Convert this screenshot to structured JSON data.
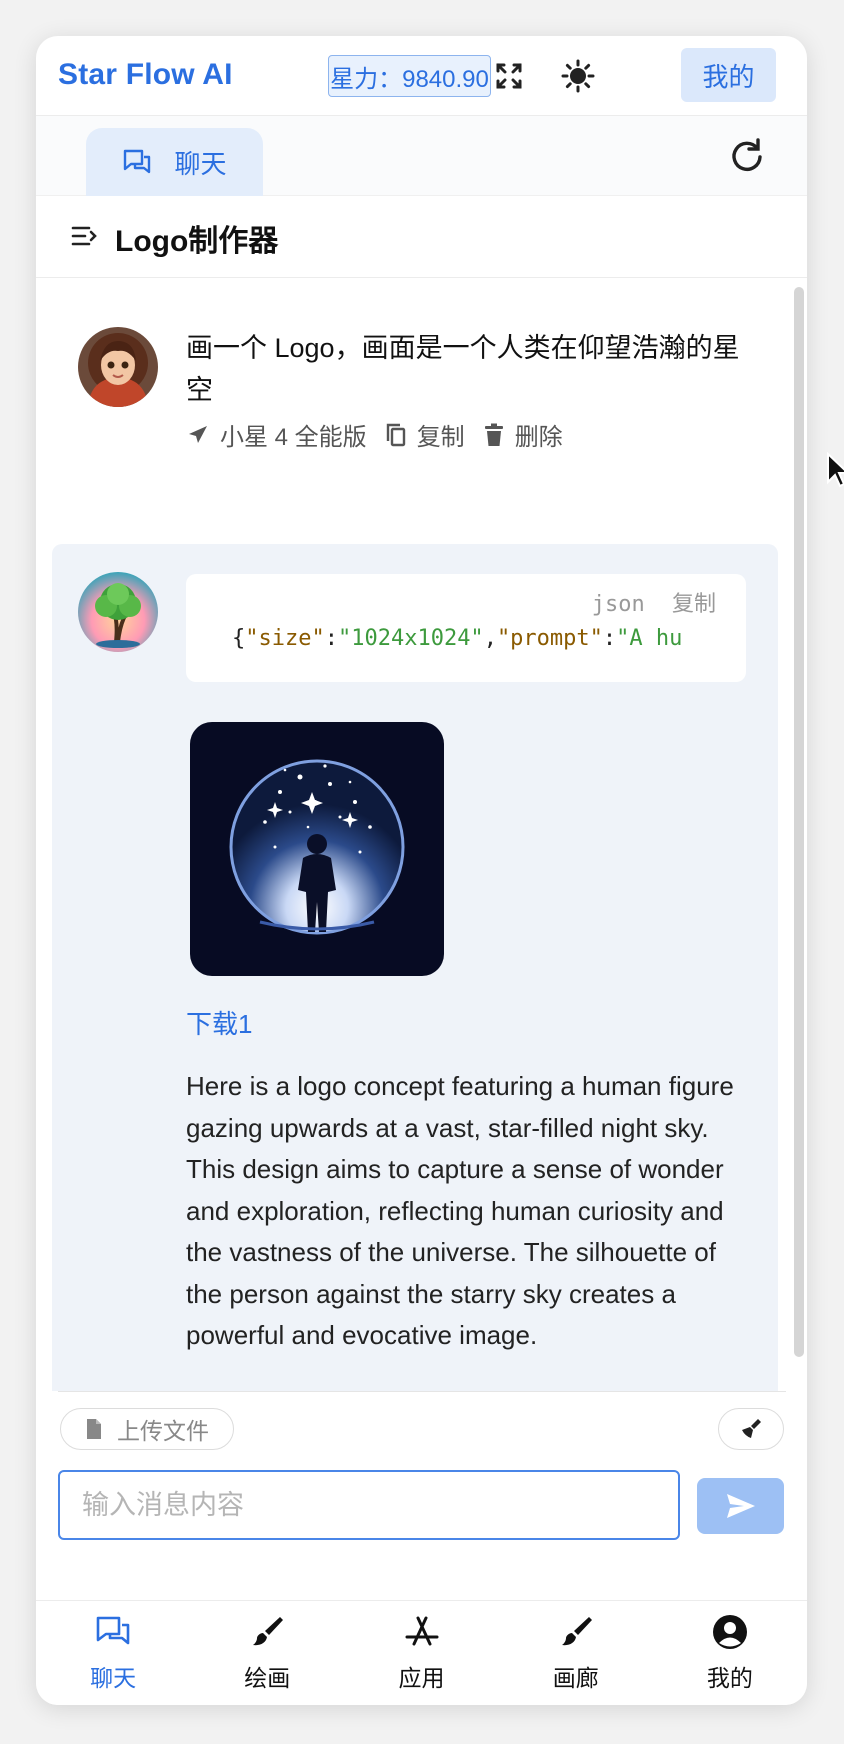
{
  "header": {
    "brand": "Star Flow AI",
    "star_power": "星力：9840.90",
    "mine_label": "我的",
    "fullscreen_icon": "fullscreen-icon",
    "theme_icon": "sun-icon"
  },
  "tabs": {
    "active_label": "聊天"
  },
  "page": {
    "title": "Logo制作器"
  },
  "chat": {
    "user_message": "画一个 Logo，画面是一个人类在仰望浩瀚的星空",
    "user_actions": {
      "model": "小星 4 全能版",
      "copy": "复制",
      "delete": "删除"
    },
    "code": {
      "lang": "json",
      "copy": "复制",
      "prefix": "{",
      "key1": "\"size\"",
      "colon1": ":",
      "val1": "\"1024x1024\"",
      "comma": ",",
      "key2": "\"prompt\"",
      "colon2": ":",
      "val2": "\"A hu"
    },
    "download_label": "下载1",
    "bot_message": "Here is a logo concept featuring a human figure gazing upwards at a vast, star-filled night sky. This design aims to capture a sense of wonder and exploration, reflecting human curiosity and the vastness of the universe. The silhouette of the person against the starry sky creates a powerful and evocative image."
  },
  "input": {
    "upload_label": "上传文件",
    "placeholder": "输入消息内容",
    "value": ""
  },
  "nav": [
    {
      "label": "聊天",
      "icon": "chat-icon",
      "active": true
    },
    {
      "label": "绘画",
      "icon": "brush-icon",
      "active": false
    },
    {
      "label": "应用",
      "icon": "apps-icon",
      "active": false
    },
    {
      "label": "画廊",
      "icon": "gallery-brush-icon",
      "active": false
    },
    {
      "label": "我的",
      "icon": "user-circle-icon",
      "active": false
    }
  ],
  "colors": {
    "accent": "#2b6fe0",
    "accent_light": "#e3edfb",
    "bot_bg": "#eff3f9",
    "send_button": "#9dc0f4"
  }
}
